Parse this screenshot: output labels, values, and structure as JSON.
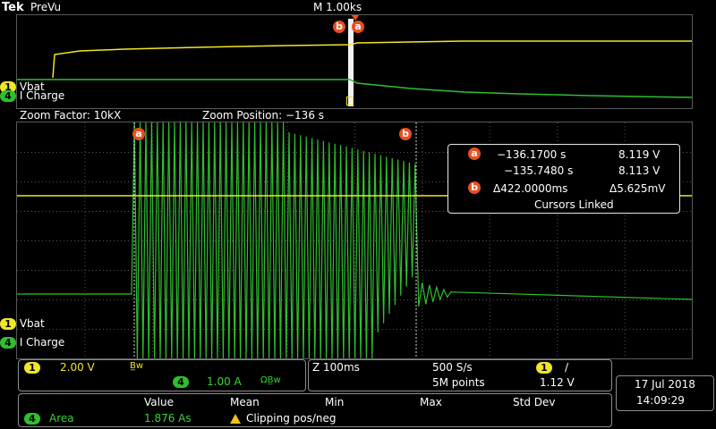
{
  "header": {
    "brand": "Tek",
    "mode": "PreVu",
    "timebase": "M 1.00ks",
    "cursor_b": "b",
    "cursor_a": "a"
  },
  "zoom_info": {
    "factor": "Zoom Factor: 10kX",
    "position": "Zoom Position: −136 s"
  },
  "channels": {
    "ch1_num": "1",
    "ch1_name": "Vbat",
    "ch4_num": "4",
    "ch4_name": "I Charge"
  },
  "cursor_readout": {
    "a_time": "−136.1700 s",
    "a_value": "8.119 V",
    "b_time": "−135.7480 s",
    "b_value": "8.113 V",
    "delta_time": "Δ422.0000ms",
    "delta_value": "Δ5.625mV",
    "linked": "Cursors Linked"
  },
  "ch_settings": {
    "ch1_num": "1",
    "ch1_scale": "2.00 V",
    "ch1_bw": "B̲w",
    "ch4_num": "4",
    "ch4_scale": "1.00 A",
    "ch4_bw": "ΩB̲w"
  },
  "horizontal": {
    "zoom_scale": "Z 100ms",
    "sample_rate": "500 S/s",
    "record": "5M points",
    "trig_ch": "1",
    "trig_slope": "/",
    "trig_level": "1.12 V"
  },
  "datetime": {
    "date": "17 Jul  2018",
    "time": "14:09:29"
  },
  "measurements": {
    "headers": [
      "Value",
      "Mean",
      "Min",
      "Max",
      "Std Dev"
    ],
    "row_ch": "4",
    "row_name": "Area",
    "row_value": "1.876 As",
    "warning": "Clipping pos/neg"
  },
  "colors": {
    "ch1": "#f0e628",
    "ch4": "#2fbf2f",
    "cursor": "#e8501e"
  }
}
